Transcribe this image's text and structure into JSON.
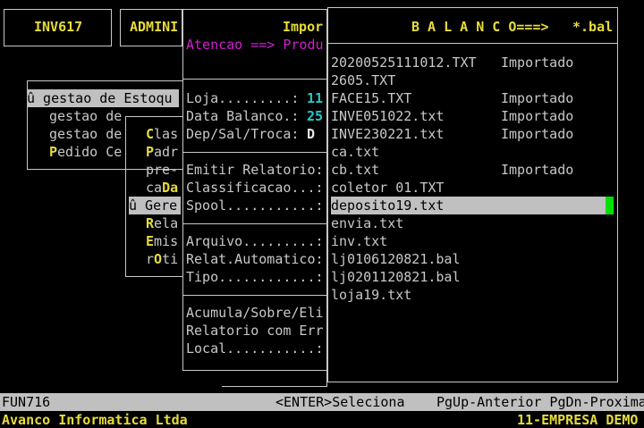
{
  "header": {
    "tab1": "INV617",
    "tab2": "ADMINI",
    "tab3": "Impor",
    "balanco_title": "B A L A N C O===>",
    "ext_filter": "*.bal"
  },
  "atencao": "Atencao ==> Produ",
  "left_menu": {
    "items": [
      "û gestao de Estoqu",
      "gestao de",
      "gestao de",
      "Pedido Ce"
    ]
  },
  "sub_menu": {
    "items": [
      "Clas",
      "Padr",
      "pre-",
      "caDa",
      "û Gere",
      "Rela",
      "Emis",
      "rOti"
    ]
  },
  "form": {
    "loja_label": "Loja.........:",
    "loja_value": "11",
    "data_label": "Data Balanco.:",
    "data_value": "25",
    "dep_label": "Dep/Sal/Troca:",
    "dep_value": "D",
    "emitir_label": "Emitir Relatorio:",
    "classificacao_label": "Classificacao...:",
    "spool_label": "Spool...........:",
    "arquivo_label": "Arquivo.........:",
    "relat_label": "Relat.Automatico:",
    "tipo_label": "Tipo............:",
    "acumula_label": "Acumula/Sobre/Eli",
    "relatorio_label": "Relatorio com Err",
    "local_label": "Local...........:"
  },
  "file_list": {
    "items": [
      {
        "name": "20200525111012.TXT",
        "status": "Importado"
      },
      {
        "name": "2605.TXT",
        "status": ""
      },
      {
        "name": "FACE15.TXT",
        "status": "Importado"
      },
      {
        "name": "INVE051022.txt",
        "status": "Importado"
      },
      {
        "name": "INVE230221.txt",
        "status": "Importado"
      },
      {
        "name": "ca.txt",
        "status": ""
      },
      {
        "name": "cb.txt",
        "status": "Importado"
      },
      {
        "name": "coletor 01.TXT",
        "status": ""
      },
      {
        "name": "deposito19.txt",
        "status": ""
      },
      {
        "name": "envia.txt",
        "status": ""
      },
      {
        "name": "inv.txt",
        "status": ""
      },
      {
        "name": "lj0106120821.bal",
        "status": ""
      },
      {
        "name": "lj0201120821.bal",
        "status": ""
      },
      {
        "name": "loja19.txt",
        "status": ""
      }
    ],
    "selected_index": 8,
    "cursor_color": "#00e000"
  },
  "status_bar": {
    "function_code": "FUN716",
    "enter_hint": "<ENTER>Seleciona",
    "page_hint": "PgUp-Anterior PgDn-Proxima"
  },
  "footer": {
    "company": "Avanco Informatica Ltda",
    "empresa": "11-EMPRESA DEMO"
  },
  "colors": {
    "background": "#000000",
    "text": "#c8c8c8",
    "highlight": "#e6dc3c",
    "accent": "#d21ed2",
    "value": "#28c8c8",
    "selection": "#c0c0c0"
  }
}
